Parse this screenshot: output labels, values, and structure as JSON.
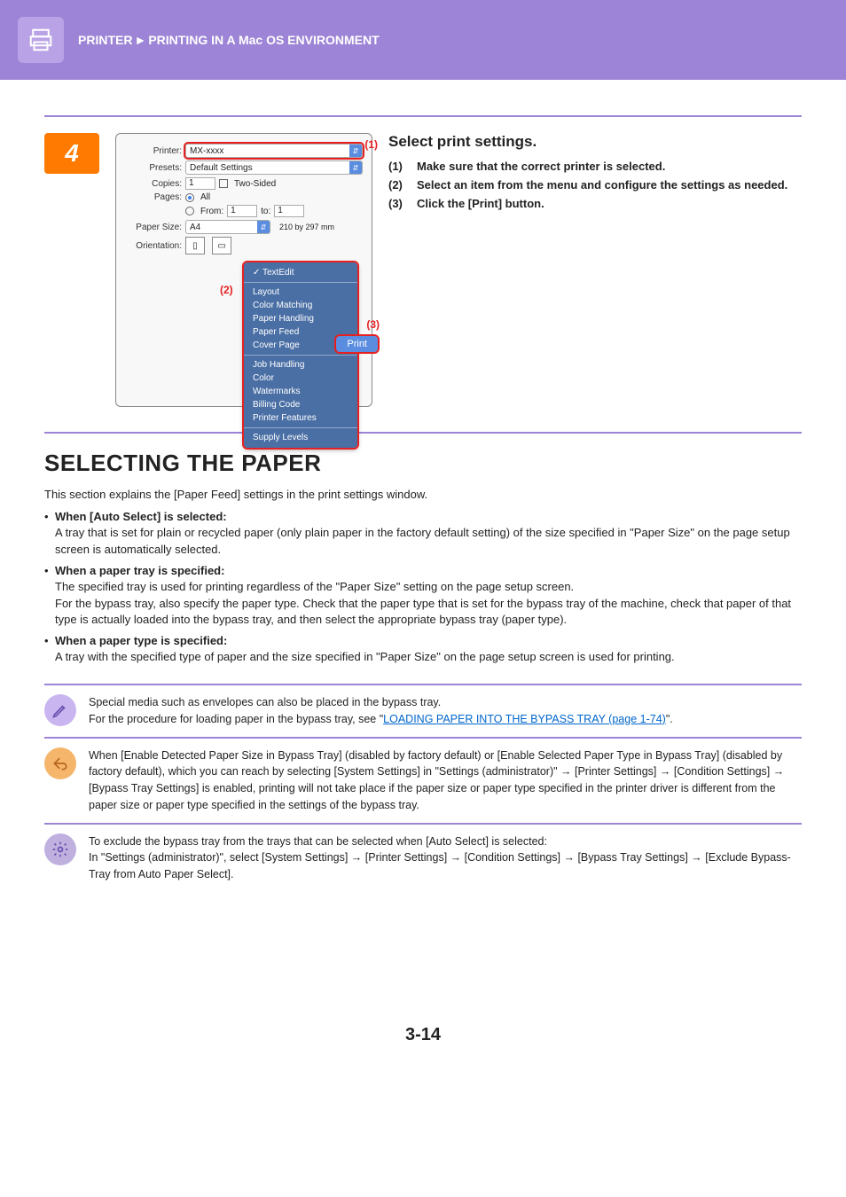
{
  "header": {
    "breadcrumb_1": "PRINTER",
    "arrow": "►",
    "breadcrumb_2": "PRINTING IN A Mac OS ENVIRONMENT"
  },
  "step": {
    "number": "4",
    "title": "Select print settings.",
    "items": [
      {
        "num": "(1)",
        "text": "Make sure that the correct printer is selected."
      },
      {
        "num": "(2)",
        "text": "Select an item from the menu and configure the settings as needed."
      },
      {
        "num": "(3)",
        "text": "Click the [Print] button."
      }
    ]
  },
  "dialog": {
    "labels": {
      "printer": "Printer:",
      "presets": "Presets:",
      "copies": "Copies:",
      "pages": "Pages:",
      "from": "From:",
      "to": "to:",
      "paper_size": "Paper Size:",
      "orientation": "Orientation:"
    },
    "printer_value": "MX-xxxx",
    "presets_value": "Default Settings",
    "copies_value": "1",
    "two_sided": "Two-Sided",
    "pages_all": "All",
    "from_value": "1",
    "to_value": "1",
    "paper_size_value": "A4",
    "paper_size_dim": "210 by 297 mm",
    "menu": {
      "active": "TextEdit",
      "group1": [
        "Layout",
        "Color Matching",
        "Paper Handling",
        "Paper Feed",
        "Cover Page"
      ],
      "group2": [
        "Job Handling",
        "Color",
        "Watermarks",
        "Billing Code",
        "Printer Features"
      ],
      "group3": [
        "Supply Levels"
      ]
    },
    "print_btn": "Print",
    "callouts": {
      "c1": "(1)",
      "c2": "(2)",
      "c3": "(3)"
    }
  },
  "section": {
    "title": "SELECTING THE PAPER",
    "lead": "This section explains the [Paper Feed] settings in the print settings window.",
    "bullets": [
      {
        "t": "When [Auto Select] is selected:",
        "d": "A tray that is set for plain or recycled paper (only plain paper in the factory default setting) of the size specified in \"Paper Size\" on the page setup screen is automatically selected."
      },
      {
        "t": "When a paper tray is specified:",
        "d": "The specified tray is used for printing regardless of the \"Paper Size\" setting on the page setup screen.\nFor the bypass tray, also specify the paper type. Check that the paper type that is set for the bypass tray of the machine, check that paper of that type is actually loaded into the bypass tray, and then select the appropriate bypass tray (paper type)."
      },
      {
        "t": "When a paper type is specified:",
        "d": "A tray with the specified type of paper and the size specified in \"Paper Size\" on the page setup screen is used for printing."
      }
    ]
  },
  "notes": {
    "n1_a": "Special media such as envelopes can also be placed in the bypass tray.",
    "n1_b": "For the procedure for loading paper in the bypass tray, see \"",
    "n1_link": "LOADING PAPER INTO THE BYPASS TRAY (page 1-74)",
    "n1_c": "\".",
    "n2": "When [Enable Detected Paper Size in Bypass Tray] (disabled by factory default) or [Enable Selected Paper Type in Bypass Tray] (disabled by factory default), which you can reach by selecting [System Settings] in \"Settings (administrator)\" → [Printer Settings] → [Condition Settings] → [Bypass Tray Settings] is enabled, printing will not take place if the paper size or paper type specified in the printer driver is different from the paper size or paper type specified in the settings of the bypass tray.",
    "n3_a": "To exclude the bypass tray from the trays that can be selected when [Auto Select] is selected:",
    "n3_b": "In \"Settings (administrator)\", select [System Settings] → [Printer Settings] → [Condition Settings] → [Bypass Tray Settings] → [Exclude Bypass-Tray from Auto Paper Select]."
  },
  "page_number": "3-14"
}
